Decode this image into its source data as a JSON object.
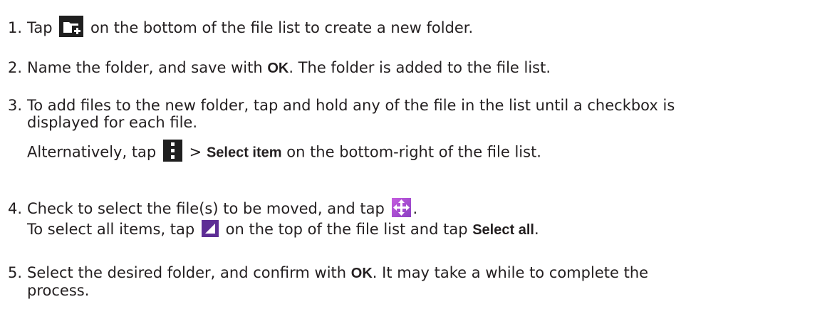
{
  "steps": [
    {
      "number": "1.",
      "parts": [
        "Tap",
        "on the bottom of the file list to create a new folder."
      ]
    },
    {
      "number": "2.",
      "parts": [
        "Name the folder, and save with ",
        "OK",
        ". The folder is added to the file list."
      ]
    },
    {
      "number": "3.",
      "line1": "To add files to the new folder, tap and hold any of the file in the list until a checkbox is",
      "line2": "displayed for each file.",
      "alt_parts": [
        "Alternatively, tap",
        ">",
        "Select item",
        "on the bottom-right of the file list."
      ]
    },
    {
      "number": "4.",
      "line1_parts": [
        "Check to select the file(s) to be moved, and tap",
        "."
      ],
      "line2_parts": [
        "To select all items, tap",
        "on the top of the file list and tap ",
        "Select all",
        "."
      ]
    },
    {
      "number": "5.",
      "parts": [
        "Select the desired folder, and confirm with ",
        "OK",
        ". It may take a while to complete the"
      ],
      "line2": "process."
    }
  ],
  "icons": {
    "new_folder": "new-folder-icon",
    "menu": "menu-icon",
    "move": "move-icon",
    "select": "select-icon"
  },
  "colors": {
    "text": "#231f20",
    "icon_dark": "#1f1f1f",
    "icon_purple": "#8a3fc2",
    "icon_select": "#5d2d95"
  }
}
